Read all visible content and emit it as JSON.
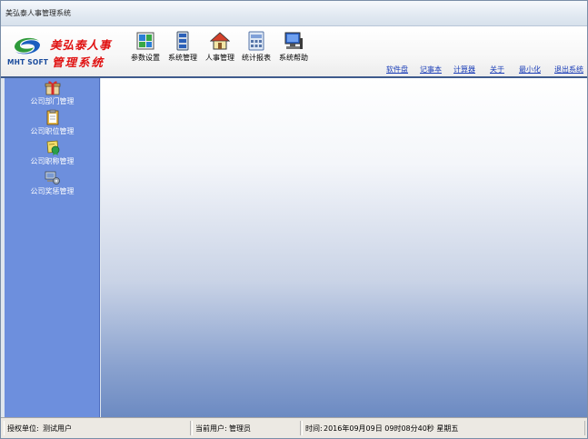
{
  "window": {
    "title": "美弘泰人事管理系统"
  },
  "logo": {
    "brand": "MHT SOFT",
    "line1": "美弘泰人事",
    "line2": "管理系统"
  },
  "toolbar": {
    "items": [
      {
        "label": "参数设置",
        "icon": "settings-icon"
      },
      {
        "label": "系统管理",
        "icon": "system-manage-icon"
      },
      {
        "label": "人事管理",
        "icon": "home-icon"
      },
      {
        "label": "统计报表",
        "icon": "report-icon"
      },
      {
        "label": "系统帮助",
        "icon": "help-computer-icon"
      }
    ]
  },
  "links": [
    "软件盘",
    "记事本",
    "计算器",
    "关于",
    "最小化",
    "退出系统"
  ],
  "sidebar": {
    "items": [
      {
        "label": "公司部门管理",
        "icon": "gift-box-icon"
      },
      {
        "label": "公司职位管理",
        "icon": "clipboard-icon"
      },
      {
        "label": "公司职称管理",
        "icon": "certificate-icon"
      },
      {
        "label": "公司奖惩管理",
        "icon": "gear-computer-icon"
      }
    ]
  },
  "status": {
    "unit_label": "授权单位:",
    "unit_value": "测试用户",
    "user_label": "当前用户:",
    "user_value": "管理员",
    "time_label": "时间:",
    "time_value": "2016年09月09日 09时08分40秒 星期五"
  },
  "colors": {
    "sidebar": "#6d8fdd",
    "link": "#1c3fb8",
    "logo_red": "#e01010",
    "logo_blue": "#1a4b9c"
  }
}
